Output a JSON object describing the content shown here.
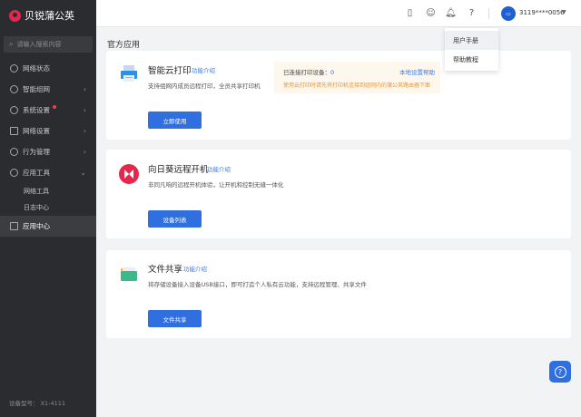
{
  "app": {
    "name": "贝锐蒲公英"
  },
  "search": {
    "placeholder": "请输入搜索内容"
  },
  "sidebar": {
    "items": [
      {
        "label": "网络状态"
      },
      {
        "label": "智能组网"
      },
      {
        "label": "系统设置"
      },
      {
        "label": "网络设置"
      },
      {
        "label": "行为管理"
      },
      {
        "label": "应用工具"
      }
    ],
    "sub_items": [
      {
        "label": "网络工具"
      },
      {
        "label": "日志中心"
      }
    ],
    "active_item": {
      "label": "应用中心"
    },
    "device_model": "设备型号： X1-4111"
  },
  "header": {
    "user": "3119****0056"
  },
  "dropdown": {
    "items": [
      {
        "label": "用户手册"
      },
      {
        "label": "帮助教程"
      }
    ]
  },
  "main": {
    "title": "官方应用",
    "cards": [
      {
        "title": "智能云打印",
        "link": "功能介绍",
        "desc": "支持组网内成员远程打印，全员共享打印机",
        "button": "立即使用",
        "notice": {
          "connected_label": "已连接打印设备：",
          "connected_count": "0",
          "help_link": "本地设置帮助",
          "tip": "使用云打印时请先将打印机连接到组网内的蒲公英路由器下面"
        }
      },
      {
        "title": "向日葵远程开机",
        "link": "功能介绍",
        "desc": "非同凡响的远程开机体验，让开机和控制无缝一体化",
        "button": "设备列表"
      },
      {
        "title": "文件共享",
        "link": "功能介绍",
        "desc": "将存储设备接入设备USB接口，即可打造个人私有云功能，支持远程管理、共享文件",
        "button": "文件共享"
      }
    ]
  },
  "colors": {
    "sidebar_bg": "#2b2c2f",
    "primary": "#2f6fe0",
    "brand": "#e6264c",
    "warning": "#f0962c"
  }
}
